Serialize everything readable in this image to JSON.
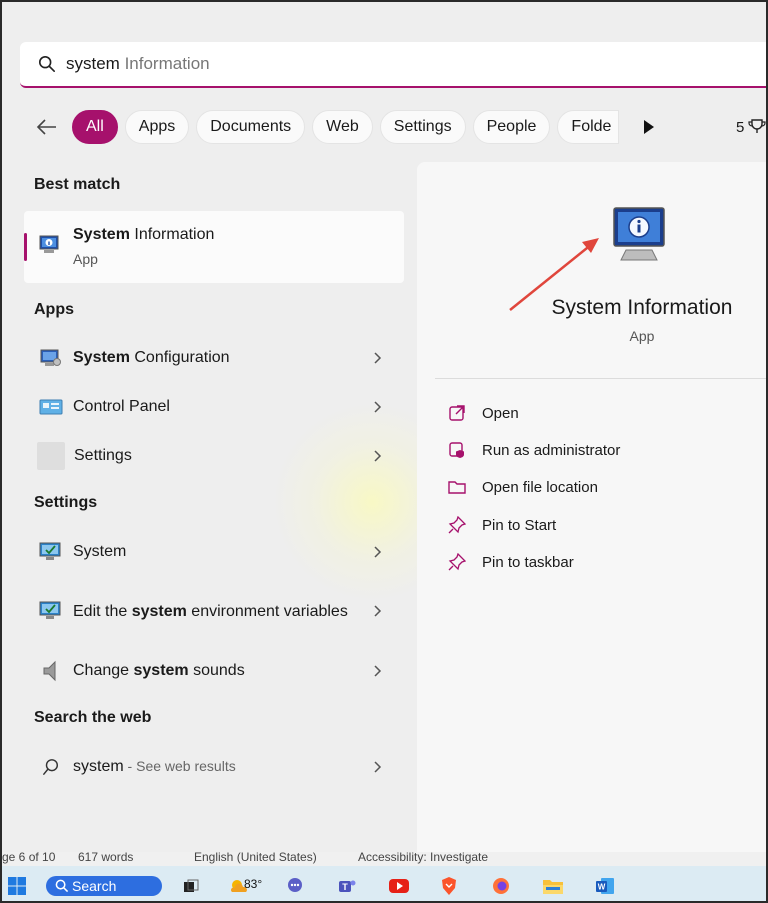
{
  "search": {
    "typed": "system",
    "suggestion": " Information"
  },
  "filters": {
    "chips": [
      "All",
      "Apps",
      "Documents",
      "Web",
      "Settings",
      "People",
      "Folde"
    ],
    "count": "5"
  },
  "sections": {
    "best_match": "Best match",
    "apps": "Apps",
    "settings": "Settings",
    "web": "Search the web"
  },
  "best_match": {
    "bold": "System",
    "rest": " Information",
    "type": "App"
  },
  "apps": [
    {
      "bold": "System",
      "rest": " Configuration"
    },
    {
      "bold": "",
      "rest": "Control Panel"
    },
    {
      "bold": "",
      "rest": "Settings"
    }
  ],
  "settings": [
    {
      "pre": "",
      "bold": "",
      "rest": "System"
    },
    {
      "pre": "Edit the ",
      "bold": "system",
      "rest": " environment variables"
    },
    {
      "pre": "Change ",
      "bold": "system",
      "rest": " sounds"
    }
  ],
  "web": {
    "query": "system",
    "sub": " - See web results"
  },
  "detail": {
    "name": "System Information",
    "type": "App",
    "actions": [
      "Open",
      "Run as administrator",
      "Open file location",
      "Pin to Start",
      "Pin to taskbar"
    ]
  },
  "statusbar": {
    "page": "ge 6 of 10",
    "words": "617 words",
    "language": "English (United States)",
    "accessibility": "Accessibility: Investigate"
  },
  "taskbar": {
    "search_label": "Search",
    "temperature": "83°"
  },
  "colors": {
    "accent": "#a6116c",
    "taskbar": "#dcebf3"
  },
  "icons": [
    "search-icon",
    "back-arrow-icon",
    "play-icon",
    "trophy-icon",
    "chevron-right-icon",
    "open-icon",
    "shield-icon",
    "folder-icon",
    "pin-icon",
    "windows-icon"
  ]
}
